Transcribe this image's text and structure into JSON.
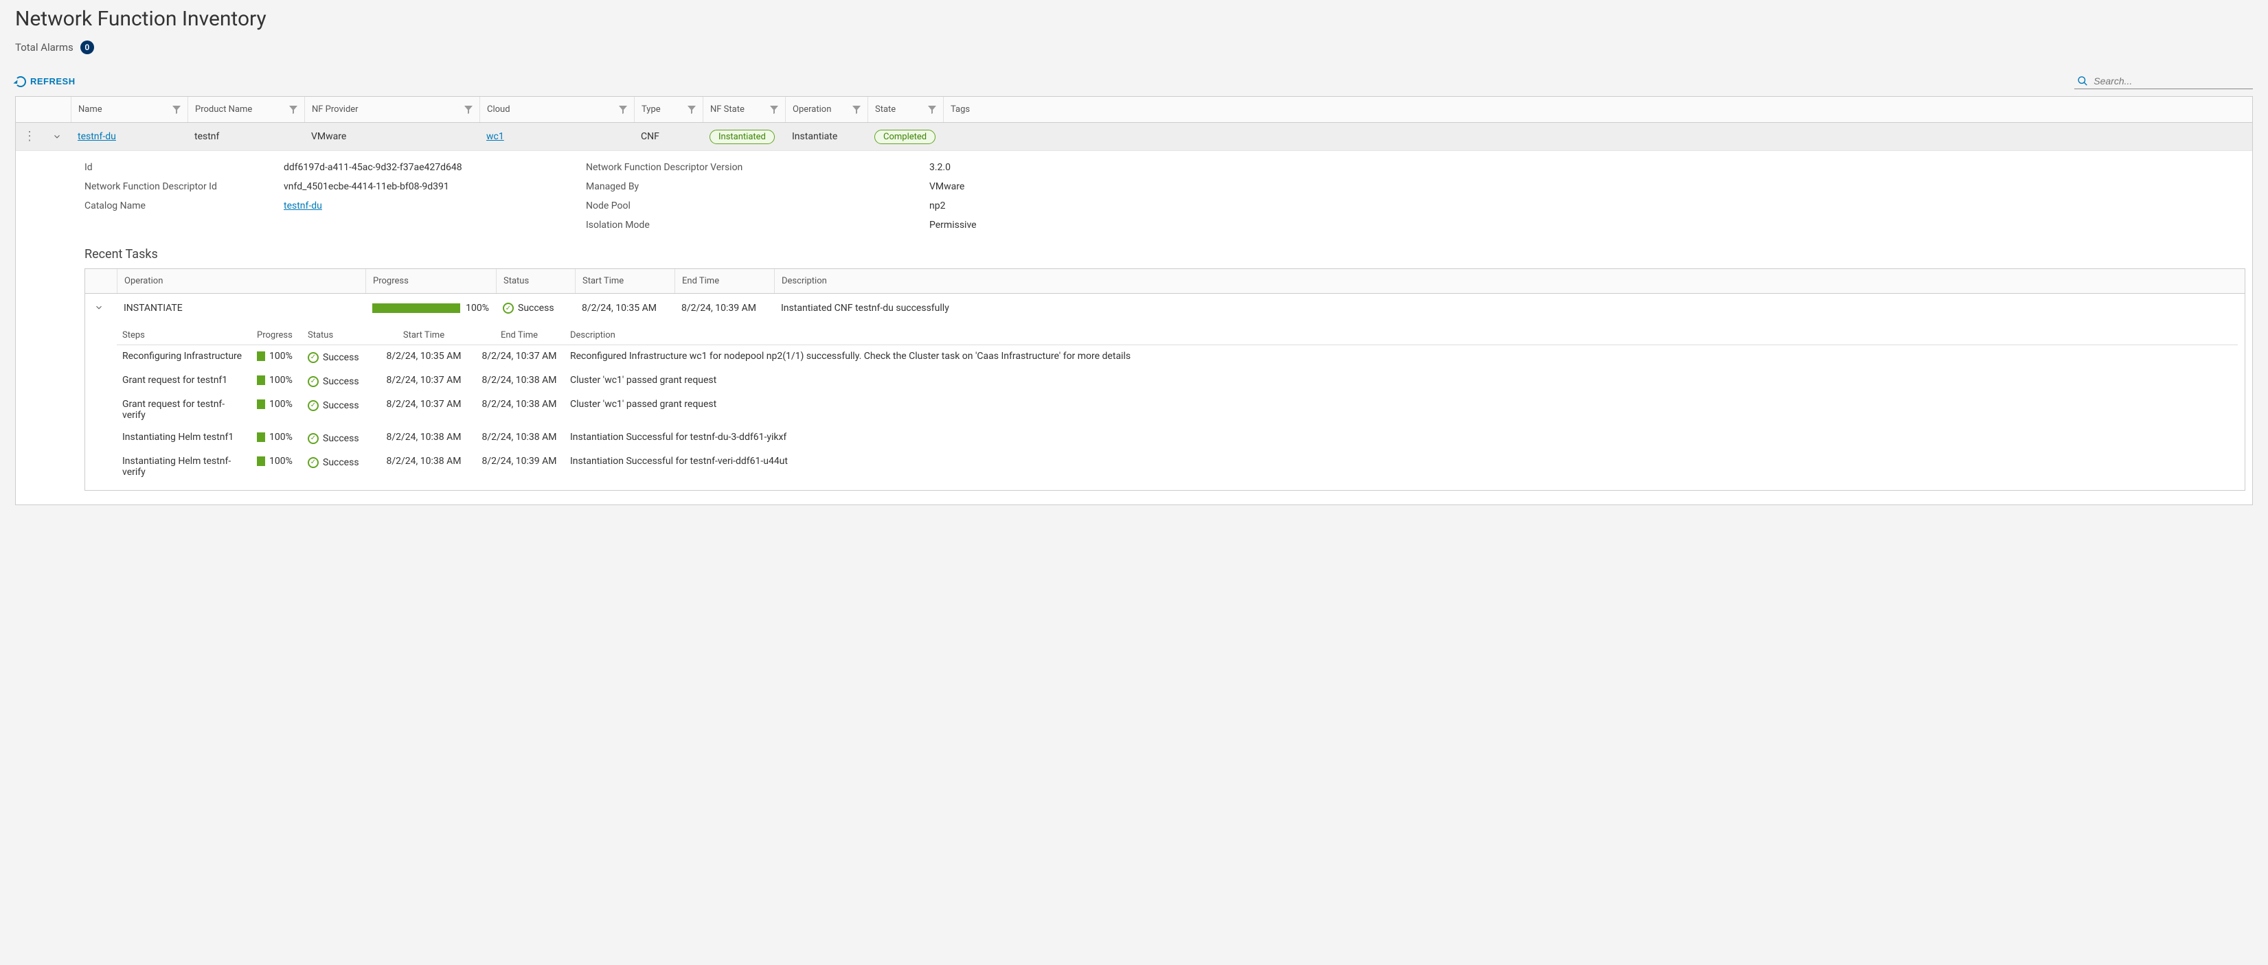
{
  "page_title": "Network Function Inventory",
  "alarms": {
    "label": "Total Alarms",
    "count": "0"
  },
  "toolbar": {
    "refresh_label": "REFRESH",
    "search_placeholder": "Search..."
  },
  "grid": {
    "headers": {
      "name": "Name",
      "product": "Product Name",
      "provider": "NF Provider",
      "cloud": "Cloud",
      "type": "Type",
      "nfstate": "NF State",
      "operation": "Operation",
      "state": "State",
      "tags": "Tags"
    },
    "row": {
      "name": "testnf-du",
      "product": "testnf",
      "provider": "VMware",
      "cloud": "wc1",
      "type": "CNF",
      "nfstate": "Instantiated",
      "operation": "Instantiate",
      "state": "Completed",
      "tags": ""
    }
  },
  "details": {
    "labels": {
      "id": "Id",
      "nfd_id": "Network Function Descriptor Id",
      "catalog": "Catalog Name",
      "nfd_ver": "Network Function Descriptor Version",
      "managed_by": "Managed By",
      "node_pool": "Node Pool",
      "isolation": "Isolation Mode"
    },
    "values": {
      "id": "ddf6197d-a411-45ac-9d32-f37ae427d648",
      "nfd_id": "vnfd_4501ecbe-4414-11eb-bf08-9d391",
      "catalog": "testnf-du",
      "nfd_ver": "3.2.0",
      "managed_by": "VMware",
      "node_pool": "np2",
      "isolation": "Permissive"
    }
  },
  "recent_tasks": {
    "title": "Recent Tasks",
    "headers": {
      "operation": "Operation",
      "progress": "Progress",
      "status": "Status",
      "start": "Start Time",
      "end": "End Time",
      "desc": "Description"
    },
    "task": {
      "operation": "INSTANTIATE",
      "progress_pct": "100%",
      "status": "Success",
      "start": "8/2/24, 10:35 AM",
      "end": "8/2/24, 10:39 AM",
      "desc": "Instantiated CNF testnf-du successfully"
    },
    "steps_headers": {
      "steps": "Steps",
      "progress": "Progress",
      "status": "Status",
      "start": "Start Time",
      "end": "End Time",
      "desc": "Description"
    },
    "steps": [
      {
        "name": "Reconfiguring Infrastructure",
        "progress": "100%",
        "status": "Success",
        "start": "8/2/24, 10:35 AM",
        "end": "8/2/24, 10:37 AM",
        "desc": "Reconfigured Infrastructure wc1 for nodepool np2(1/1) successfully. Check the Cluster task on 'Caas Infrastructure' for more details"
      },
      {
        "name": "Grant request for testnf1",
        "progress": "100%",
        "status": "Success",
        "start": "8/2/24, 10:37 AM",
        "end": "8/2/24, 10:38 AM",
        "desc": "Cluster 'wc1' passed grant request"
      },
      {
        "name": "Grant request for testnf-verify",
        "progress": "100%",
        "status": "Success",
        "start": "8/2/24, 10:37 AM",
        "end": "8/2/24, 10:38 AM",
        "desc": "Cluster 'wc1' passed grant request"
      },
      {
        "name": "Instantiating Helm testnf1",
        "progress": "100%",
        "status": "Success",
        "start": "8/2/24, 10:38 AM",
        "end": "8/2/24, 10:38 AM",
        "desc": "Instantiation Successful for testnf-du-3-ddf61-yikxf"
      },
      {
        "name": "Instantiating Helm testnf-verify",
        "progress": "100%",
        "status": "Success",
        "start": "8/2/24, 10:38 AM",
        "end": "8/2/24, 10:39 AM",
        "desc": "Instantiation Successful for testnf-veri-ddf61-u44ut"
      }
    ]
  }
}
